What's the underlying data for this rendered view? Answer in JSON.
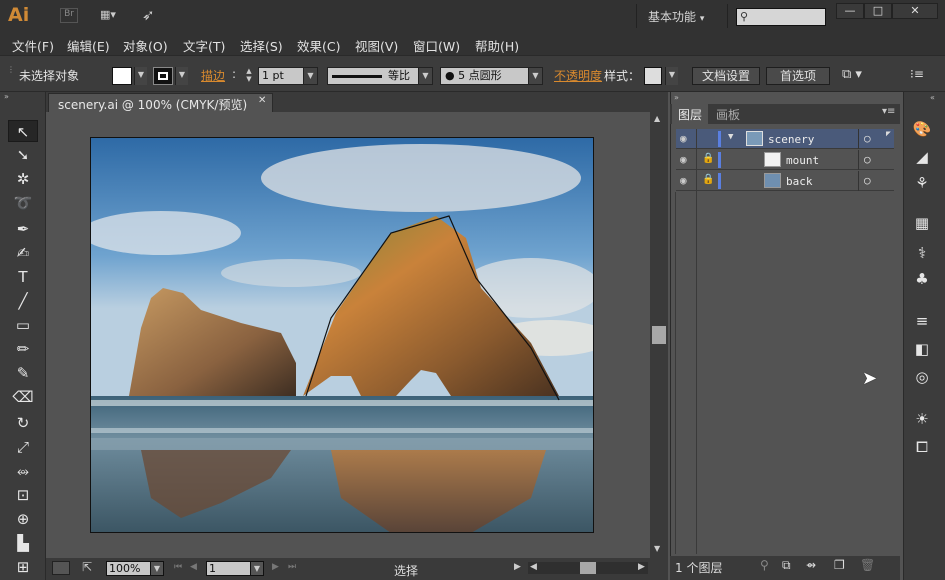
{
  "app": {
    "logo": "Ai",
    "br": "Br"
  },
  "workspace": {
    "label": "基本功能",
    "arrow": "▾"
  },
  "window_buttons": {
    "minimize": "—",
    "restore": "□",
    "close": "✕"
  },
  "menu": [
    "文件(F)",
    "编辑(E)",
    "对象(O)",
    "文字(T)",
    "选择(S)",
    "效果(C)",
    "视图(V)",
    "窗口(W)",
    "帮助(H)"
  ],
  "control": {
    "selection": "未选择对象",
    "stroke_label": "描边",
    "stroke_value": "1 pt",
    "profile": "等比",
    "brush": "● 5 点圆形",
    "opacity_label": "不透明度",
    "style_label": "样式：",
    "doc_setup": "文档设置",
    "preferences": "首选项"
  },
  "document": {
    "tab_title": "scenery.ai @ 100% (CMYK/预览)",
    "close": "✕"
  },
  "status": {
    "zoom": "100%",
    "page": "1",
    "tool": "选择"
  },
  "panel": {
    "tabs": [
      "图层",
      "画板"
    ],
    "layers": [
      {
        "name": "scenery",
        "level": 0,
        "expanded": true
      },
      {
        "name": "mount",
        "level": 1,
        "locked": true
      },
      {
        "name": "back",
        "level": 1,
        "locked": true
      }
    ],
    "count": "1 个图层"
  },
  "colors": {
    "accent": "#d98a2e",
    "selection_blue": "#5a7fe0",
    "chrome": "#323232"
  }
}
